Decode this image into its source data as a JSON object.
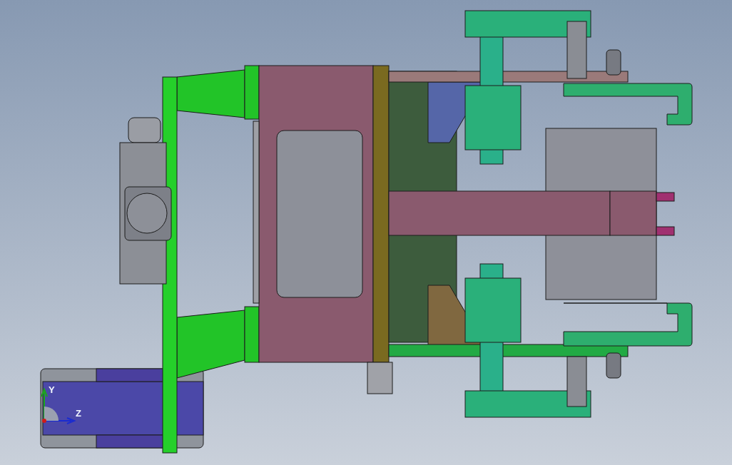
{
  "viewport": {
    "triad": {
      "axes": [
        {
          "label": "Y",
          "kind": "vertical"
        },
        {
          "label": "Z",
          "kind": "horizontal"
        }
      ]
    }
  }
}
